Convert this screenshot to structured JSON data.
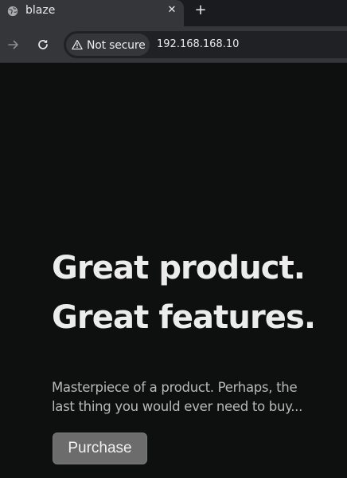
{
  "browser": {
    "tab": {
      "title": "blaze",
      "close_glyph": "✕",
      "favicon": "globe-icon"
    },
    "new_tab_glyph": "+",
    "toolbar": {
      "forward_icon": "arrow-right-icon",
      "reload_icon": "reload-icon",
      "security": {
        "icon": "warning-icon",
        "label": "Not secure"
      },
      "url": "192.168.168.10"
    }
  },
  "hero": {
    "headline_line1": "Great product.",
    "headline_line2": "Great features.",
    "subtext": "Masterpiece of a product. Perhaps, the last thing you would ever need to buy...",
    "button_label": "Purchase"
  },
  "colors": {
    "page_background": "#0e0f0f",
    "browser_chrome": "#35363a",
    "headline": "#ececec",
    "subtext": "#b9b9b9",
    "button_background": "#6c6c6c"
  }
}
